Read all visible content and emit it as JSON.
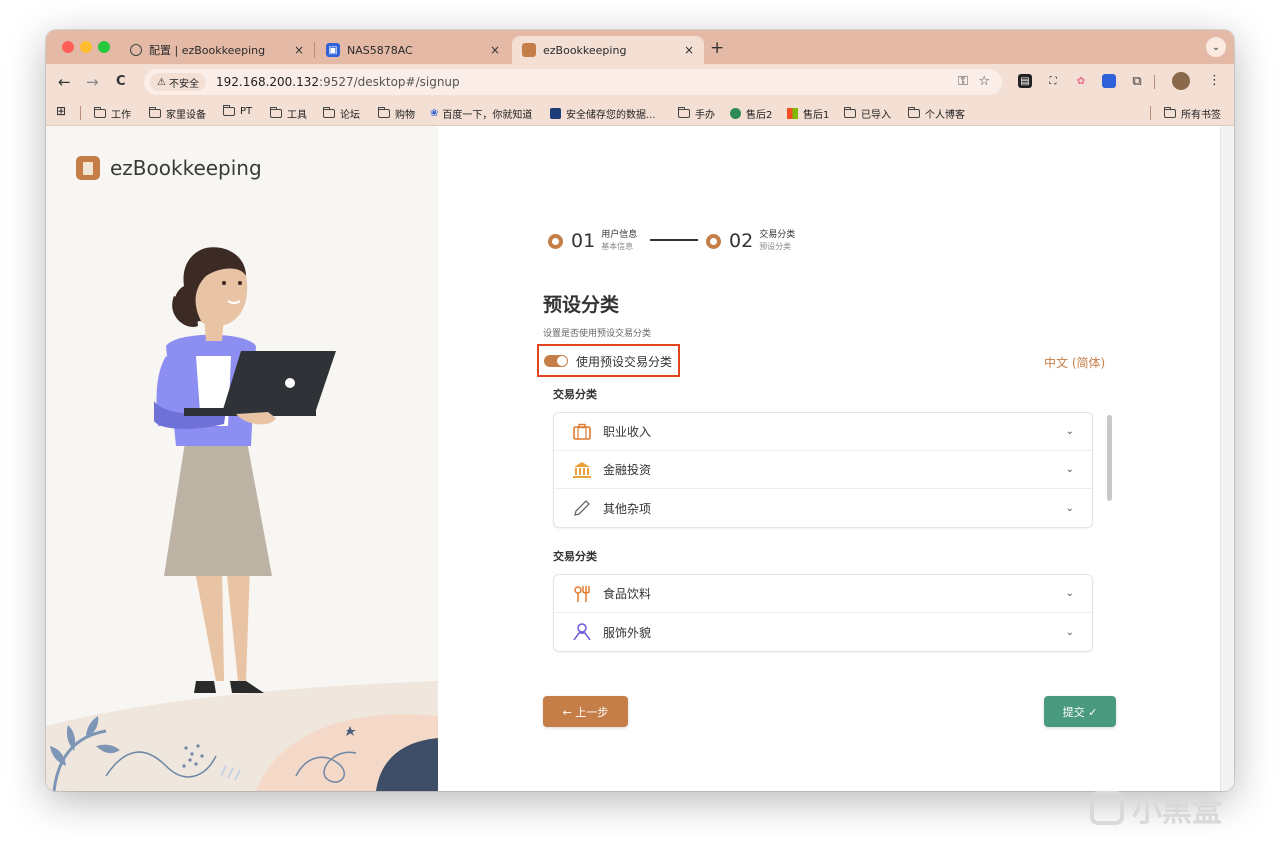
{
  "browser": {
    "tabs": [
      {
        "label": "配置 | ezBookkeeping",
        "icon": "globe-icon"
      },
      {
        "label": "NAS5878AC",
        "icon": "nas-icon"
      },
      {
        "label": "ezBookkeeping",
        "icon": "ezbookkeeping-icon"
      }
    ],
    "tab_close": "×",
    "new_tab": "+",
    "back": "←",
    "forward": "→",
    "reload": "C",
    "security_label": "不安全",
    "url_host": "192.168.200.132",
    "url_path": ":9527/desktop#/signup",
    "bookmarks": [
      "工作",
      "家里设备",
      "PT",
      "工具",
      "论坛",
      "购物",
      "百度一下，你就知道",
      "安全储存您的数据...",
      "手办",
      "售后2",
      "售后1",
      "已导入",
      "个人博客"
    ],
    "all_bookmarks": "所有书签"
  },
  "app": {
    "brand": "ezBookkeeping",
    "steps": [
      {
        "num": "01",
        "title": "用户信息",
        "sub": "基本信息"
      },
      {
        "num": "02",
        "title": "交易分类",
        "sub": "预设分类"
      }
    ],
    "heading": "预设分类",
    "subtitle": "设置是否使用预设交易分类",
    "toggle_label": "使用预设交易分类",
    "toggle_on": true,
    "language": "中文 (简体)",
    "sections": [
      {
        "title": "交易分类",
        "items": [
          {
            "label": "职业收入",
            "icon": "briefcase-icon"
          },
          {
            "label": "金融投资",
            "icon": "bank-icon"
          },
          {
            "label": "其他杂项",
            "icon": "pencil-icon"
          }
        ]
      },
      {
        "title": "交易分类",
        "items": [
          {
            "label": "食品饮料",
            "icon": "food-icon"
          },
          {
            "label": "服饰外貌",
            "icon": "person-icon"
          }
        ]
      }
    ],
    "prev_button": "← 上一步",
    "submit_button": "提交 ✓",
    "accent_color": "#c67e48",
    "submit_color": "#4a9a80"
  },
  "watermark": "小黑盒"
}
